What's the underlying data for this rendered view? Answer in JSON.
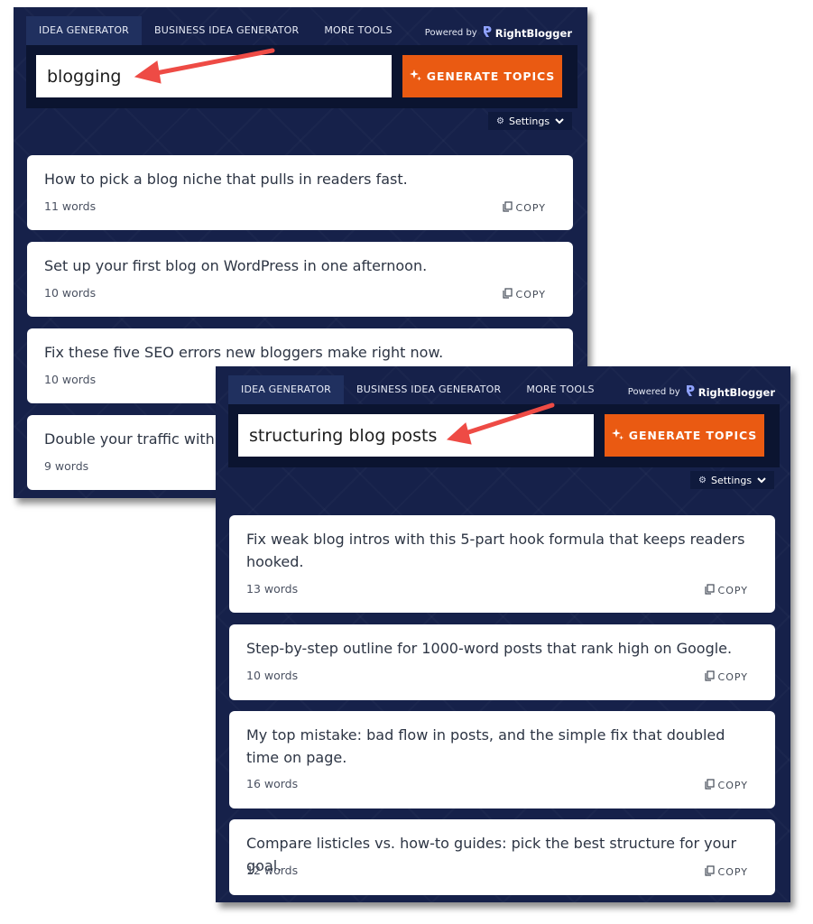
{
  "accent_color": "#ea5a12",
  "panel_color": "#16214a",
  "panels": [
    {
      "tabs": [
        "IDEA GENERATOR",
        "BUSINESS IDEA GENERATOR",
        "MORE TOOLS"
      ],
      "active_tab": 0,
      "powered_by": "Powered by",
      "brand": "RightBlogger",
      "search_value": "blogging",
      "generate_label": "GENERATE TOPICS",
      "settings_label": "Settings",
      "copy_label": "COPY",
      "results": [
        {
          "text": "How to pick a blog niche that pulls in readers fast.",
          "words": "11 words"
        },
        {
          "text": "Set up your first blog on WordPress in one afternoon.",
          "words": "10 words"
        },
        {
          "text": "Fix these five SEO errors new bloggers make right now.",
          "words": "10 words"
        },
        {
          "text": "Double your traffic with g",
          "words": "9 words"
        }
      ]
    },
    {
      "tabs": [
        "IDEA GENERATOR",
        "BUSINESS IDEA GENERATOR",
        "MORE TOOLS"
      ],
      "active_tab": 0,
      "powered_by": "Powered by",
      "brand": "RightBlogger",
      "search_value": "structuring blog posts",
      "generate_label": "GENERATE TOPICS",
      "settings_label": "Settings",
      "copy_label": "COPY",
      "results": [
        {
          "text": "Fix weak blog intros with this 5-part hook formula that keeps readers hooked.",
          "words": "13 words"
        },
        {
          "text": "Step-by-step outline for 1000-word posts that rank high on Google.",
          "words": "10 words"
        },
        {
          "text": "My top mistake: bad flow in posts, and the simple fix that doubled time on page.",
          "words": "16 words"
        },
        {
          "text": "Compare listicles vs. how-to guides: pick the best structure for your goal.",
          "words": "12 words"
        }
      ]
    }
  ]
}
